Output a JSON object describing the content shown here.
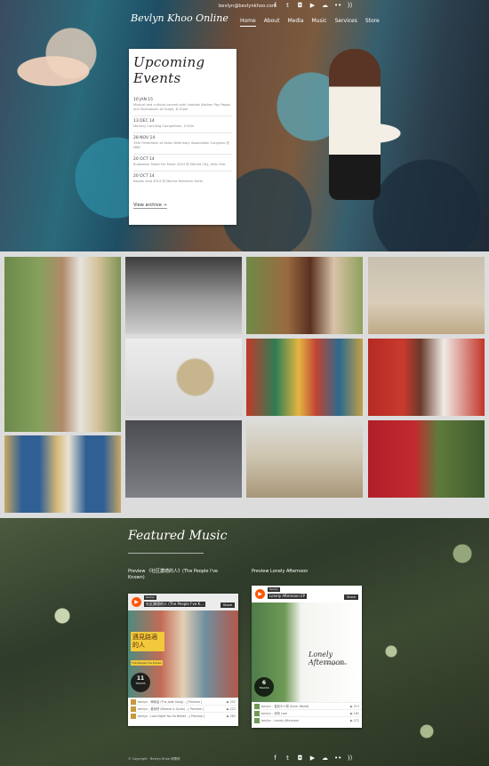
{
  "header": {
    "email": "bevlyn@bevlynkhoo.com",
    "brand": "Bevlyn Khoo Online",
    "social_icons": [
      "facebook-icon",
      "twitter-icon",
      "instagram-icon",
      "youtube-icon",
      "cloud-icon",
      "flickr-icon",
      "rss-icon"
    ],
    "social_glyphs": [
      "f",
      "t",
      "◘",
      "▶",
      "☁",
      "••",
      "))"
    ],
    "nav": [
      {
        "label": "Home",
        "active": true
      },
      {
        "label": "About"
      },
      {
        "label": "Media"
      },
      {
        "label": "Music"
      },
      {
        "label": "Services"
      },
      {
        "label": "Store"
      }
    ]
  },
  "events": {
    "title": "Upcoming Events",
    "items": [
      {
        "date": "10 JAN 15",
        "text": "Musical and cultural concert with Lambak Alsthon Pay Pagoh and Youthaholic at Scape, 8.15pm"
      },
      {
        "date": "13 DEC 14",
        "text": "Ministry Carolling Competition, 5:30m"
      },
      {
        "date": "28 NOV 14",
        "text": "19th Federation of Asian Veterinary Association Congress @ MBS"
      },
      {
        "date": "20 OCT 14",
        "text": "Budweiser Made For Music 2014 @ Market City, Attic Hub"
      },
      {
        "date": "20 OCT 14",
        "text": "Kaplan Asia 2014 @ Marina Mandarin Hotel"
      }
    ],
    "archive_label": "View archive →"
  },
  "music": {
    "title": "Featured Music",
    "player1": {
      "label": "Preview 《社区讚適的人》(The People I've Known)",
      "tag": "bevlyn",
      "title": "社区讚適的人 (The People I've K…",
      "share": "Share",
      "cover_text": "遇見路適的人",
      "cover_sub": "The People I've Known",
      "count": "11",
      "count_label": "TRACKS",
      "tracks": [
        {
          "name": "bevlyn - 梅城谣 (The Jade Song) - [ Preview ]",
          "plays": "▶ 252"
        },
        {
          "name": "bevlyn - 爱我吧 (Breeze & Gusts) - [ Preview ]",
          "plays": "▶ 222"
        },
        {
          "name": "bevlyn - Last Night You So Better - [ Preview ]",
          "plays": "▶ 283"
        }
      ],
      "cookie": "Cookie policy"
    },
    "player2": {
      "label": "Preview Lonely Afternoon",
      "tag": "bevlyn",
      "title": "Lonely Afternoon EP",
      "share": "Share",
      "cover_text": "Lonely Afternoon",
      "cover_sub": "Bevlyn Khoo",
      "count": "6",
      "count_label": "TRACKS",
      "tracks": [
        {
          "name": "bevlyn - 曾如今人物 (Inner World)",
          "plays": "▶ 213"
        },
        {
          "name": "bevlyn - 深刻 Last",
          "plays": "▶ 181"
        },
        {
          "name": "bevlyn - Lonely Afternoon",
          "plays": "▶ 272"
        }
      ],
      "cookie": "Cookie policy"
    }
  },
  "footer": {
    "copyright": "© Copyright · Bevlyn Khoo 邱蕾林"
  },
  "colors": {
    "accent": "#ff5500",
    "brand_text": "#ffffff"
  }
}
